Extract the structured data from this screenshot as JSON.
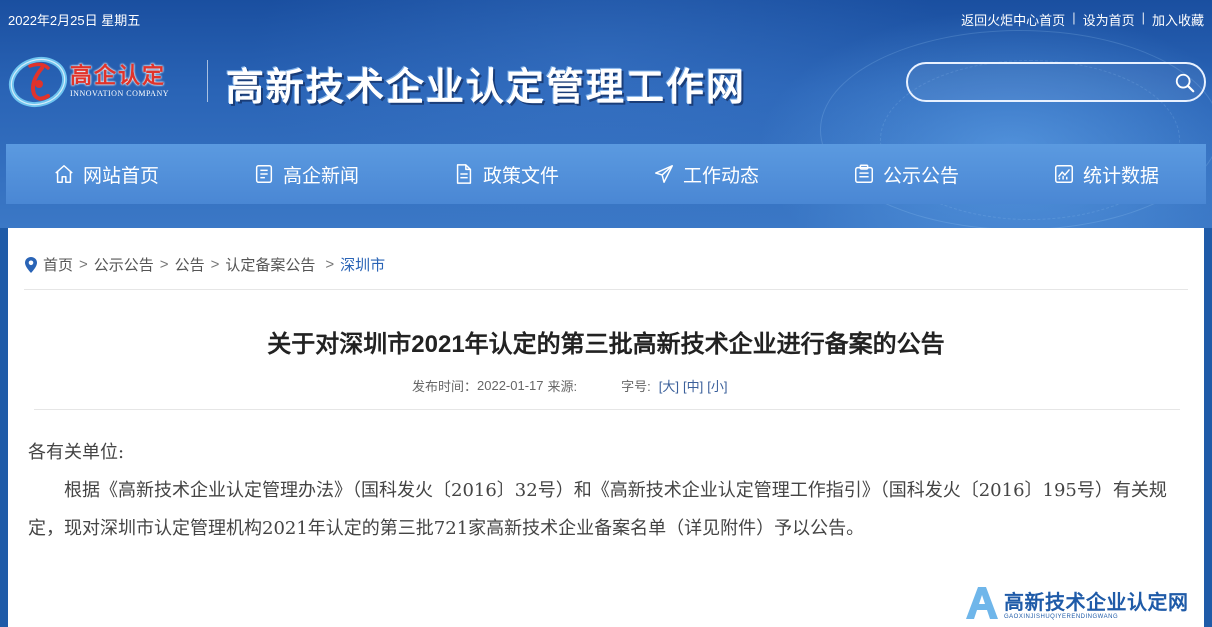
{
  "header": {
    "date": "2022年2月25日 星期五",
    "links": [
      {
        "label": "返回火炬中心首页"
      },
      {
        "label": "设为首页"
      },
      {
        "label": "加入收藏"
      }
    ],
    "logo_cn": "高企认定",
    "logo_en": "INNOVATION COMPANY",
    "site_title": "高新技术企业认定管理工作网",
    "search_placeholder": ""
  },
  "nav": {
    "items": [
      {
        "label": "网站首页",
        "icon": "home-icon"
      },
      {
        "label": "高企新闻",
        "icon": "news-icon"
      },
      {
        "label": "政策文件",
        "icon": "document-icon"
      },
      {
        "label": "工作动态",
        "icon": "paper-plane-icon"
      },
      {
        "label": "公示公告",
        "icon": "clipboard-icon"
      },
      {
        "label": "统计数据",
        "icon": "chart-icon"
      }
    ]
  },
  "breadcrumb": {
    "items": [
      "首页",
      "公示公告",
      "公告",
      "认定备案公告",
      "深圳市"
    ],
    "separator": ">"
  },
  "article": {
    "title": "关于对深圳市2021年认定的第三批高新技术企业进行备案的公告",
    "publish_label": "发布时间：",
    "publish_date": "2022-01-17",
    "source_label": "来源:",
    "font_size_label": "字号:",
    "font_sizes": [
      "[大]",
      "[中]",
      "[小]"
    ],
    "salutation": "各有关单位:",
    "paragraph": "根据《高新技术企业认定管理办法》（国科发火〔2016〕32号）和《高新技术企业认定管理工作指引》（国科发火〔2016〕195号）有关规定，现对深圳市认定管理机构2021年认定的第三批721家高新技术企业备案名单（详见附件）予以公告。"
  },
  "watermark": {
    "cn": "高新技术企业认定网",
    "en": "GAOXINJISHUQIYERENDINGWANG"
  },
  "colors": {
    "header_bg": "#2a64b6",
    "nav_bg": "#4a87d4",
    "logo_red": "#e0332b",
    "breadcrumb_current": "#2a64b6"
  }
}
